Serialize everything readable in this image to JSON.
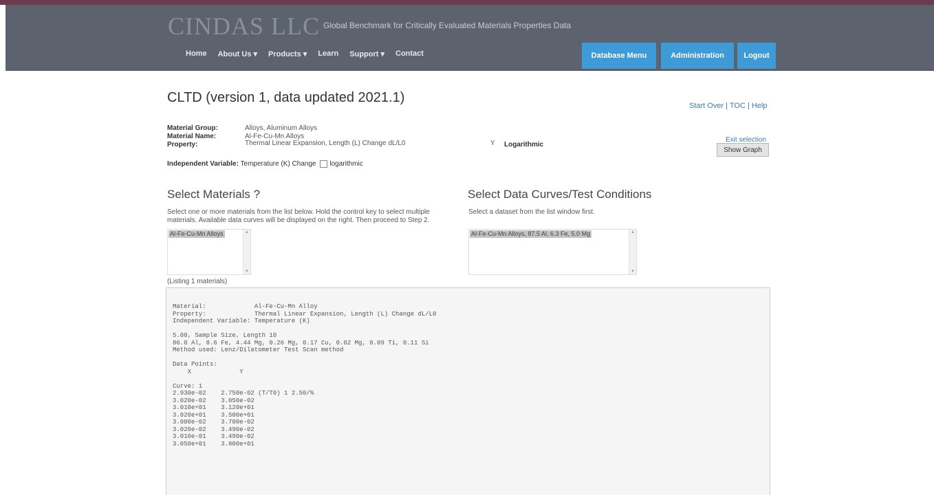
{
  "header": {
    "brand": "CINDAS LLC",
    "tagline": "Global Benchmark for Critically Evaluated Materials Properties Data",
    "menu": [
      "Home",
      "About Us ▾",
      "Products ▾",
      "Learn",
      "Support ▾",
      "Contact"
    ],
    "buttons": {
      "database_menu": "Database Menu",
      "administration": "Administration",
      "logout": "Logout"
    },
    "colors": {
      "topline": "#6e3a4e",
      "navbar": "#5c636e",
      "button": "#3f9ad8"
    }
  },
  "page": {
    "title": "CLTD (version 1, data updated 2021.1)",
    "links": {
      "start_over": "Start Over",
      "toc": "TOC",
      "help": "Help",
      "sep": " | "
    }
  },
  "meta": {
    "material_group_label": "Material Group:",
    "material_group_value": "Alloys, Aluminum Alloys",
    "material_name_label": "Material Name:",
    "material_name_value": "Al-Fe-Cu-Mn Alloys",
    "property_label": "Property:",
    "property_value": "Thermal Linear Expansion, Length (L) Change dL/L0",
    "scale_value": "Y",
    "logarithmic_label": "Logarithmic",
    "independent_label": "Independent Variable:",
    "independent_value": "Temperature (K)",
    "independent_change": "Change",
    "independent_log": "logarithmic"
  },
  "side": {
    "link": "Exit selection",
    "show_graph": "Show Graph"
  },
  "materials": {
    "heading": "Select Materials ?",
    "instruction": "Select one or more materials from the list below. Hold the control key to select multiple materials. Available data curves will be displayed on the right. Then proceed to Step 2.",
    "options": [
      "Al-Fe-Cu-Mn Alloys"
    ],
    "count": "(Listing 1 materials)"
  },
  "curves": {
    "heading": "Select Data Curves/Test Conditions",
    "instruction": "Select a dataset from the list window first.",
    "options": [
      "Al-Fe-Cu-Mn Alloys, 87.5 Al, 6.3 Fe, 5.0 Mg"
    ]
  },
  "data_block": {
    "lines": [
      "Material:             Al-Fe-Cu-Mn Alloy",
      "Property:             Thermal Linear Expansion, Length (L) Change dL/L0",
      "Independent Variable: Temperature (K)",
      "",
      "5.00, Sample Size, Length 10",
      "86.0 Al, 8.6 Fe, 4.44 Mg, 0.26 Mg, 0.17 Cu, 0.02 Mg, 0.09 Ti, 0.11 Si",
      "Method used: Lenz/Dilatometer Test Scan method",
      "",
      "Data Points:",
      "    X             Y",
      "",
      "Curve: 1",
      "2.930e-02    2.750e-02 (T/T0) 1 2.50/%",
      "3.020e-02    3.050e-02",
      "3.010e+01    3.120e+01",
      "3.020e+01    3.500e+01",
      "3.000e-02    3.700e-02",
      "3.020e-02    3.490e-02",
      "3.010e-01    3.490e-02",
      "3.050e+01    3.800e+01"
    ]
  }
}
